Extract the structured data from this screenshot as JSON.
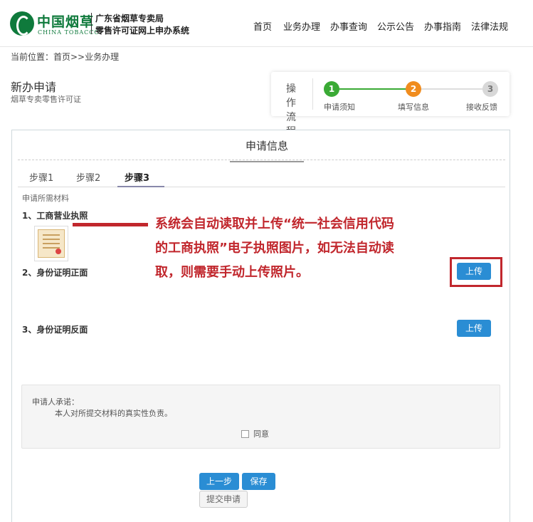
{
  "header": {
    "logo_cn": "中国烟草",
    "logo_en": "CHINA TOBACCO",
    "system_line1": "广东省烟草专卖局",
    "system_line2": "零售许可证网上申办系统",
    "nav": [
      "首页",
      "业务办理",
      "办事查询",
      "公示公告",
      "办事指南",
      "法律法规"
    ]
  },
  "breadcrumb": "当前位置：首页>>业务办理",
  "page": {
    "title": "新办申请",
    "subtitle": "烟草专卖零售许可证"
  },
  "flow": {
    "label": "操作流程",
    "steps": [
      {
        "num": "1",
        "label": "申请须知",
        "color": "#3aaa35"
      },
      {
        "num": "2",
        "label": "填写信息",
        "color": "#f08c1e"
      },
      {
        "num": "3",
        "label": "接收反馈",
        "color": "#d8d8d8"
      }
    ]
  },
  "panel": {
    "title": "申请信息",
    "tabs": [
      "步骤1",
      "步骤2",
      "步骤3"
    ],
    "active_tab": 2,
    "materials_label": "申请所需材料",
    "items": [
      "1、工商营业执照",
      "2、身份证明正面",
      "3、身份证明反面"
    ],
    "upload_label": "上传"
  },
  "annotation": {
    "text": "系统会自动读取并上传“统一社会信用代码的工商执照”电子执照图片，如无法自动读取，则需要手动上传照片。",
    "color": "#c1272d"
  },
  "promise": {
    "title": "申请人承诺：",
    "text": "本人对所提交材料的真实性负责。",
    "agree_label": "同意"
  },
  "buttons": {
    "prev": "上一步",
    "save": "保存",
    "submit": "提交申请"
  }
}
